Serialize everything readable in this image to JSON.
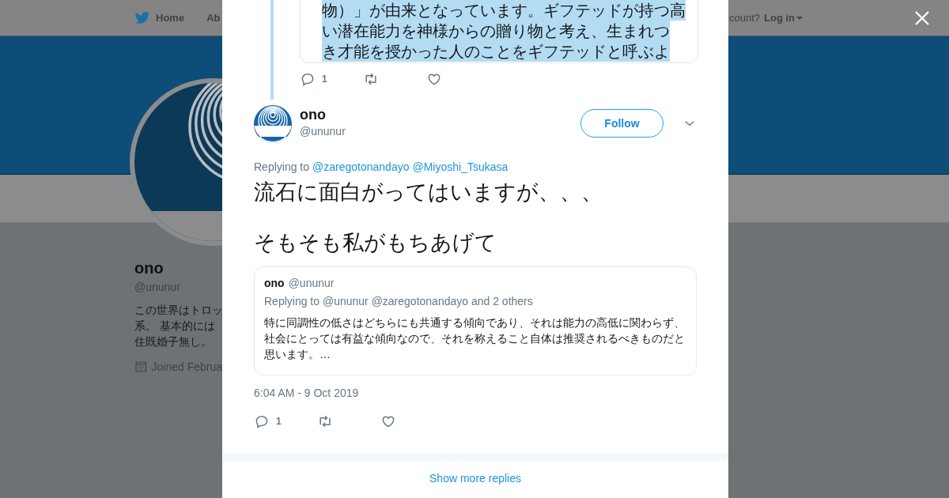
{
  "nav": {
    "items": [
      {
        "label": "Home",
        "kind": "home"
      },
      {
        "label": "Ab",
        "kind": "link"
      }
    ],
    "account_prompt": "count?",
    "login": "Log in"
  },
  "profile": {
    "name": "ono",
    "handle": "@ununur",
    "bio": [
      "この世界はトロッ",
      "系。 基本的には",
      "住既婚子無し。"
    ],
    "joined": "Joined Februa"
  },
  "modal": {
    "parent_tweet": {
      "lines": [
        "物）」が由来となっています。ギフテッドが持つ高",
        "い潜在能力を神様からの贈り物と考え、生まれつ",
        "き才能を授かった人のことをギフテッドと呼ぶよ"
      ],
      "selected": true,
      "reply_count": "1"
    },
    "tweet": {
      "name": "ono",
      "handle": "@ununur",
      "follow": "Follow",
      "replying_label": "Replying to",
      "mentions": [
        "@zaregotonandayo",
        "@Miyoshi_Tsukasa"
      ],
      "text": [
        "流石に面白がってはいますが、、、",
        "そもそも私がもちあげて"
      ],
      "quote": {
        "name": "ono",
        "handle": "@ununur",
        "replying": "Replying to @ununur @zaregotonandayo and 2 others",
        "text": "特に同調性の低さはどちらにも共通する傾向であり、それは能力の高低に関わらず、社会にとっては有益な傾向なので、それを称えること自体は推奨されるべきものだと思います。…"
      },
      "timestamp": "6:04 AM - 9 Oct 2019",
      "reply_count": "1"
    },
    "show_more": "Show more replies"
  }
}
